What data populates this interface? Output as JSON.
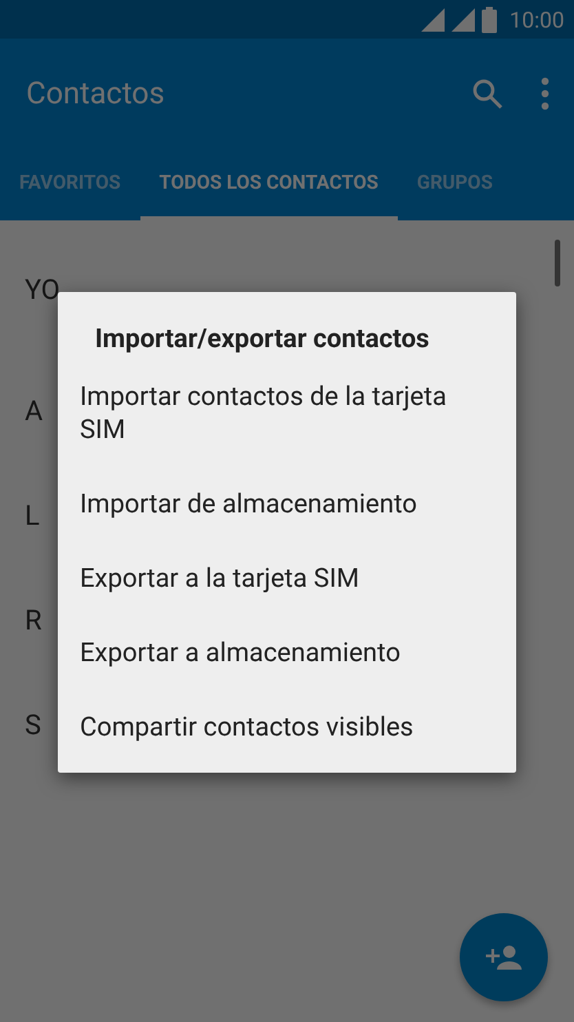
{
  "status_bar": {
    "time": "10:00"
  },
  "app_bar": {
    "title": "Contactos"
  },
  "tabs": [
    {
      "label": "FAVORITOS",
      "selected": false
    },
    {
      "label": "TODOS LOS CONTACTOS",
      "selected": true
    },
    {
      "label": "GRUPOS",
      "selected": false
    }
  ],
  "profile": {
    "label": "YO"
  },
  "section_letters": [
    "A",
    "L",
    "R",
    "S"
  ],
  "dialog": {
    "title": "Importar/exportar contactos",
    "items": [
      "Importar contactos de la tarjeta SIM",
      "Importar de almacenamiento",
      "Exportar a la tarjeta SIM",
      "Exportar a almacenamiento",
      "Compartir contactos visibles"
    ]
  }
}
